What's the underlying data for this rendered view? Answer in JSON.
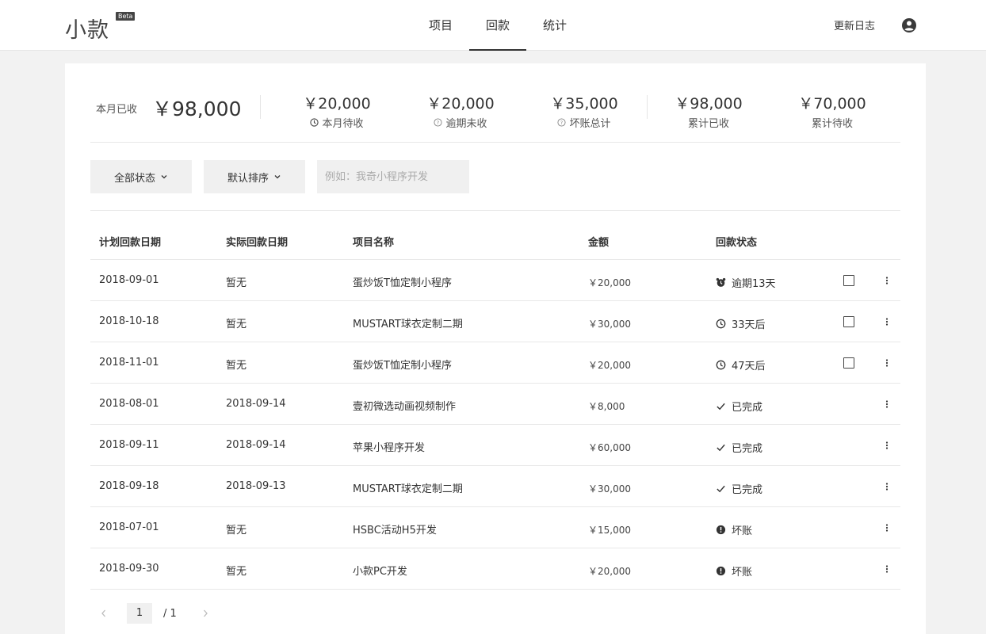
{
  "app": {
    "logo": "小款",
    "badge": "Beta"
  },
  "nav": {
    "items": [
      {
        "label": "项目"
      },
      {
        "label": "回款"
      },
      {
        "label": "统计"
      }
    ],
    "active": "回款"
  },
  "header": {
    "changelog": "更新日志",
    "user_icon": "user-circle-icon"
  },
  "summary": {
    "month_received_label": "本月已收",
    "month_received_value": "￥98,000",
    "stats": [
      {
        "value": "￥20,000",
        "label": "本月待收",
        "icon": "clock-icon"
      },
      {
        "value": "￥20,000",
        "label": "逾期未收",
        "icon": "question-circle-icon"
      },
      {
        "value": "￥35,000",
        "label": "坏账总计",
        "icon": "question-circle-icon"
      },
      {
        "value": "￥98,000",
        "label": "累计已收"
      },
      {
        "value": "￥70,000",
        "label": "累计待收"
      }
    ]
  },
  "filters": {
    "status_label": "全部状态",
    "sort_label": "默认排序",
    "search_placeholder": "例如：我奇小程序开发"
  },
  "table": {
    "headers": [
      "计划回款日期",
      "实际回款日期",
      "项目名称",
      "金额",
      "回款状态"
    ],
    "rows": [
      {
        "planned": "2018-09-01",
        "actual": "暂无",
        "project": "蛋炒饭T恤定制小程序",
        "amount": "￥20,000",
        "status": "逾期13天",
        "status_type": "overdue",
        "checkbox": true
      },
      {
        "planned": "2018-10-18",
        "actual": "暂无",
        "project": "MUSTART球衣定制二期",
        "amount": "￥30,000",
        "status": "33天后",
        "status_type": "pending",
        "checkbox": true
      },
      {
        "planned": "2018-11-01",
        "actual": "暂无",
        "project": "蛋炒饭T恤定制小程序",
        "amount": "￥20,000",
        "status": "47天后",
        "status_type": "pending",
        "checkbox": true
      },
      {
        "planned": "2018-08-01",
        "actual": "2018-09-14",
        "project": "壹初微选动画视频制作",
        "amount": "￥8,000",
        "status": "已完成",
        "status_type": "done",
        "checkbox": false
      },
      {
        "planned": "2018-09-11",
        "actual": "2018-09-14",
        "project": "苹果小程序开发",
        "amount": "￥60,000",
        "status": "已完成",
        "status_type": "done",
        "checkbox": false
      },
      {
        "planned": "2018-09-18",
        "actual": "2018-09-13",
        "project": "MUSTART球衣定制二期",
        "amount": "￥30,000",
        "status": "已完成",
        "status_type": "done",
        "checkbox": false
      },
      {
        "planned": "2018-07-01",
        "actual": "暂无",
        "project": "HSBC活动H5开发",
        "amount": "￥15,000",
        "status": "坏账",
        "status_type": "bad",
        "checkbox": false
      },
      {
        "planned": "2018-09-30",
        "actual": "暂无",
        "project": "小款PC开发",
        "amount": "￥20,000",
        "status": "坏账",
        "status_type": "bad",
        "checkbox": false
      }
    ]
  },
  "pagination": {
    "current": "1",
    "total": "/  1"
  }
}
